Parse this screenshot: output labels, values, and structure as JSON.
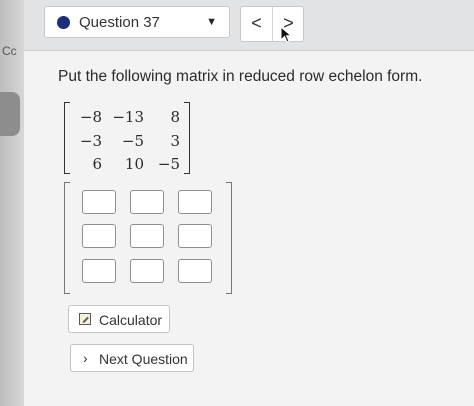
{
  "sidebar": {
    "truncated_text": "Cc"
  },
  "header": {
    "question_selector": {
      "label": "Question 37",
      "status_color": "#1c2f78"
    },
    "prev_label": "<",
    "next_label": ">"
  },
  "main": {
    "prompt": "Put the following matrix in reduced row echelon form.",
    "given_matrix": [
      [
        "−8",
        "−13",
        "8"
      ],
      [
        "−3",
        "−5",
        "3"
      ],
      [
        "6",
        "10",
        "−5"
      ]
    ],
    "answer_matrix": {
      "rows": 3,
      "cols": 3,
      "values": [
        [
          "",
          "",
          ""
        ],
        [
          "",
          "",
          ""
        ],
        [
          "",
          "",
          ""
        ]
      ]
    },
    "calculator_label": "Calculator",
    "next_question_label": "Next Question",
    "next_question_icon": "chevron-right-icon"
  }
}
